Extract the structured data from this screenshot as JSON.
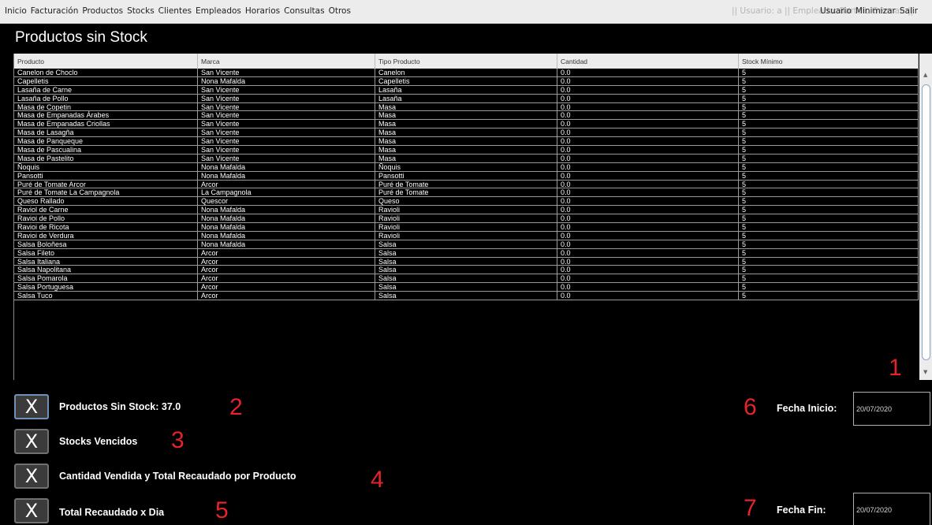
{
  "menu": {
    "items": [
      "Inicio",
      "Facturación",
      "Productos",
      "Stocks",
      "Clientes",
      "Empleados",
      "Horarios",
      "Consultas",
      "Otros"
    ],
    "user_info": "|| Usuario: a || Empleado: Bartoli, German ||",
    "right_items": [
      "Usuario",
      "Minimizar",
      "Salir"
    ]
  },
  "page": {
    "title": "Productos sin Stock"
  },
  "table": {
    "headers": [
      "Producto",
      "Marca",
      "Tipo Producto",
      "Cantidad",
      "Stock Mínimo"
    ],
    "rows": [
      [
        "Canelon de Choclo",
        "San Vicente",
        "Canelon",
        "0.0",
        "5"
      ],
      [
        "Capelletis",
        "Nona Mafalda",
        "Capelletis",
        "0.0",
        "5"
      ],
      [
        "Lasaña de Carne",
        "San Vicente",
        "Lasaña",
        "0.0",
        "5"
      ],
      [
        "Lasaña de Pollo",
        "San Vicente",
        "Lasaña",
        "0.0",
        "5"
      ],
      [
        "Masa de Copetin",
        "San Vicente",
        "Masa",
        "0.0",
        "5"
      ],
      [
        "Masa de Empanadas Árabes",
        "San Vicente",
        "Masa",
        "0.0",
        "5"
      ],
      [
        "Masa de Empanadas Criollas",
        "San Vicente",
        "Masa",
        "0.0",
        "5"
      ],
      [
        "Masa de Lasagña",
        "San Vicente",
        "Masa",
        "0.0",
        "5"
      ],
      [
        "Masa de Panqueque",
        "San Vicente",
        "Masa",
        "0.0",
        "5"
      ],
      [
        "Masa de Pascualina",
        "San Vicente",
        "Masa",
        "0.0",
        "5"
      ],
      [
        "Masa de Pastelito",
        "San Vicente",
        "Masa",
        "0.0",
        "5"
      ],
      [
        "Ñoquis",
        "Nona Mafalda",
        "Ñoquis",
        "0.0",
        "5"
      ],
      [
        "Pansotti",
        "Nona Mafalda",
        "Pansotti",
        "0.0",
        "5"
      ],
      [
        "Puré de Tomate Arcor",
        "Arcor",
        "Puré de Tomate",
        "0.0",
        "5"
      ],
      [
        "Puré de Tomate La Campagnola",
        "La Campagnola",
        "Puré de Tomate",
        "0.0",
        "5"
      ],
      [
        "Queso Rallado",
        "Quescor",
        "Queso",
        "0.0",
        "5"
      ],
      [
        "Raviol de Carne",
        "Nona Mafalda",
        "Ravioli",
        "0.0",
        "5"
      ],
      [
        "Ravioi de Pollo",
        "Nona Mafalda",
        "Ravioli",
        "0.0",
        "5"
      ],
      [
        "Ravioi de Ricota",
        "Nona Mafalda",
        "Ravioli",
        "0.0",
        "5"
      ],
      [
        "Ravioi de Verdura",
        "Nona Mafalda",
        "Ravioli",
        "0.0",
        "5"
      ],
      [
        "Salsa Boloñesa",
        "Nona Mafalda",
        "Salsa",
        "0.0",
        "5"
      ],
      [
        "Salsa Fileto",
        "Arcor",
        "Salsa",
        "0.0",
        "5"
      ],
      [
        "Salsa Italiana",
        "Arcor",
        "Salsa",
        "0.0",
        "5"
      ],
      [
        "Salsa Napolitana",
        "Arcor",
        "Salsa",
        "0.0",
        "5"
      ],
      [
        "Salsa Pomarola",
        "Arcor",
        "Salsa",
        "0.0",
        "5"
      ],
      [
        "Salsa Portuguesa",
        "Arcor",
        "Salsa",
        "0.0",
        "5"
      ],
      [
        "Salsa Tuco",
        "Arcor",
        "Salsa",
        "0.0",
        "5"
      ]
    ]
  },
  "buttons": [
    {
      "x": "X",
      "label": "Productos Sin Stock: 37.0",
      "marker": "2"
    },
    {
      "x": "X",
      "label": "Stocks Vencidos",
      "marker": "3"
    },
    {
      "x": "X",
      "label": "Cantidad Vendida y Total Recaudado por Producto",
      "marker": "4"
    },
    {
      "x": "X",
      "label": "Total Recaudado x Dia",
      "marker": "5"
    }
  ],
  "markers": {
    "table": "1",
    "fecha_inicio": "6",
    "fecha_fin": "7"
  },
  "fecha_inicio": {
    "label": "Fecha Inicio:",
    "value": "20/07/2020"
  },
  "fecha_fin": {
    "label": "Fecha Fin:",
    "value": "20/07/2020"
  }
}
